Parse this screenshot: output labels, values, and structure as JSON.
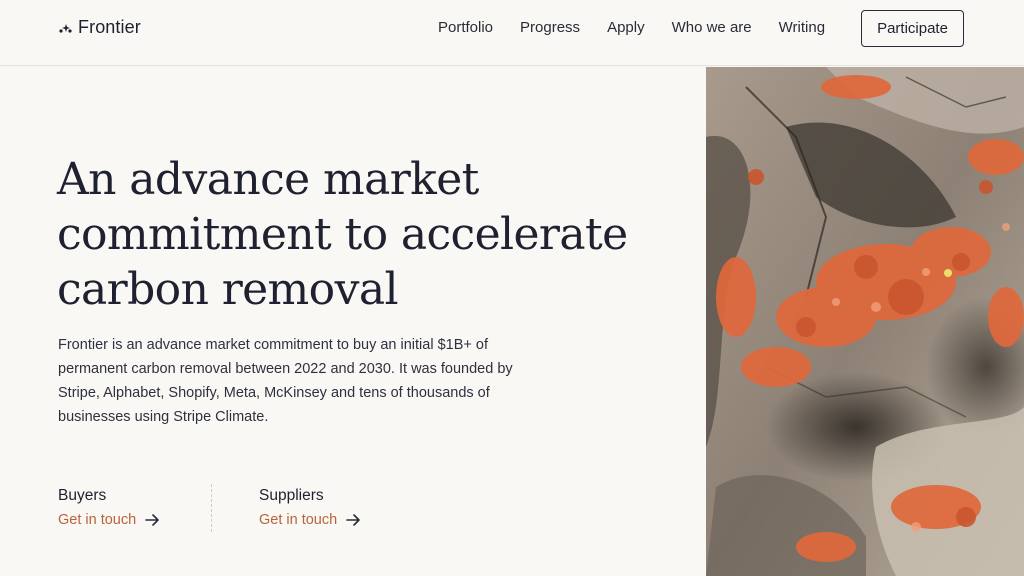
{
  "brand": {
    "name": "Frontier",
    "logo_icon": "sparkle-dots-icon"
  },
  "nav": {
    "items": [
      {
        "label": "Portfolio"
      },
      {
        "label": "Progress"
      },
      {
        "label": "Apply"
      },
      {
        "label": "Who we are"
      },
      {
        "label": "Writing"
      }
    ],
    "cta_label": "Participate"
  },
  "hero": {
    "headline": "An advance market commitment to accelerate carbon removal",
    "body": "Frontier is an advance market commitment to buy an initial $1B+ of permanent carbon removal between 2022 and 2030. It was founded by Stripe, Alphabet, Shopify, Meta, McKinsey and tens of thousands of businesses using Stripe Climate."
  },
  "cards": [
    {
      "title": "Buyers",
      "link_label": "Get in touch",
      "icon": "arrow-right-icon"
    },
    {
      "title": "Suppliers",
      "link_label": "Get in touch",
      "icon": "arrow-right-icon"
    }
  ],
  "colors": {
    "background": "#faf8f5",
    "text": "#2a2b38",
    "accent_link": "#b8643a",
    "lichen": "#e0683c"
  }
}
